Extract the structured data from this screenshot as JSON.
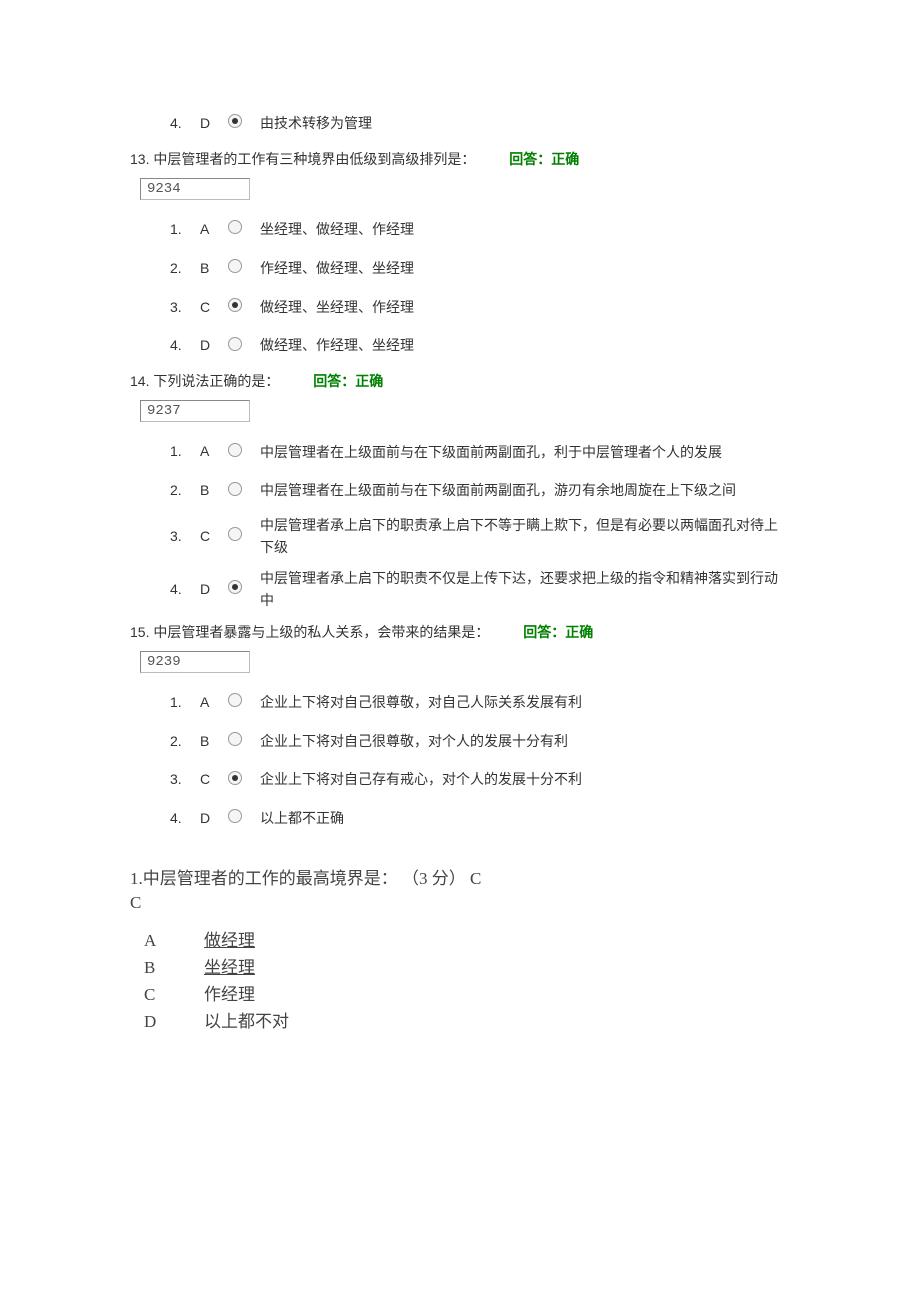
{
  "q12": {
    "option4": {
      "num": "4.",
      "letter": "D",
      "text": "由技术转移为管理",
      "selected": true
    }
  },
  "q13": {
    "header": {
      "num": "13.",
      "text": "中层管理者的工作有三种境界由低级到高级排列是：",
      "feedback": "回答：正确"
    },
    "boxValue": "9234",
    "options": [
      {
        "num": "1.",
        "letter": "A",
        "text": "坐经理、做经理、作经理",
        "selected": false
      },
      {
        "num": "2.",
        "letter": "B",
        "text": "作经理、做经理、坐经理",
        "selected": false
      },
      {
        "num": "3.",
        "letter": "C",
        "text": "做经理、坐经理、作经理",
        "selected": true
      },
      {
        "num": "4.",
        "letter": "D",
        "text": "做经理、作经理、坐经理",
        "selected": false
      }
    ]
  },
  "q14": {
    "header": {
      "num": "14.",
      "text": "下列说法正确的是：",
      "feedback": "回答：正确"
    },
    "boxValue": "9237",
    "options": [
      {
        "num": "1.",
        "letter": "A",
        "text": "中层管理者在上级面前与在下级面前两副面孔，利于中层管理者个人的发展",
        "selected": false
      },
      {
        "num": "2.",
        "letter": "B",
        "text": "中层管理者在上级面前与在下级面前两副面孔，游刃有余地周旋在上下级之间",
        "selected": false
      },
      {
        "num": "3.",
        "letter": "C",
        "text": "中层管理者承上启下的职责承上启下不等于瞒上欺下，但是有必要以两幅面孔对待上下级",
        "selected": false
      },
      {
        "num": "4.",
        "letter": "D",
        "text": "中层管理者承上启下的职责不仅是上传下达，还要求把上级的指令和精神落实到行动中",
        "selected": true
      }
    ]
  },
  "q15": {
    "header": {
      "num": "15.",
      "text": "中层管理者暴露与上级的私人关系，会带来的结果是：",
      "feedback": "回答：正确"
    },
    "boxValue": "9239",
    "options": [
      {
        "num": "1.",
        "letter": "A",
        "text": "企业上下将对自己很尊敬，对自己人际关系发展有利",
        "selected": false
      },
      {
        "num": "2.",
        "letter": "B",
        "text": "企业上下将对自己很尊敬，对个人的发展十分有利",
        "selected": false
      },
      {
        "num": "3.",
        "letter": "C",
        "text": "企业上下将对自己存有戒心，对个人的发展十分不利",
        "selected": true
      },
      {
        "num": "4.",
        "letter": "D",
        "text": "以上都不正确",
        "selected": false
      }
    ]
  },
  "bottom": {
    "header": "1.中层管理者的工作的最高境界是： （3 分）  C",
    "answer": "C",
    "options": [
      {
        "letter": "A",
        "text": "做经理",
        "link": true
      },
      {
        "letter": "B",
        "text": "坐经理",
        "link": true
      },
      {
        "letter": "C",
        "text": "作经理",
        "link": false
      },
      {
        "letter": "D",
        "text": "以上都不对",
        "link": false
      }
    ]
  }
}
